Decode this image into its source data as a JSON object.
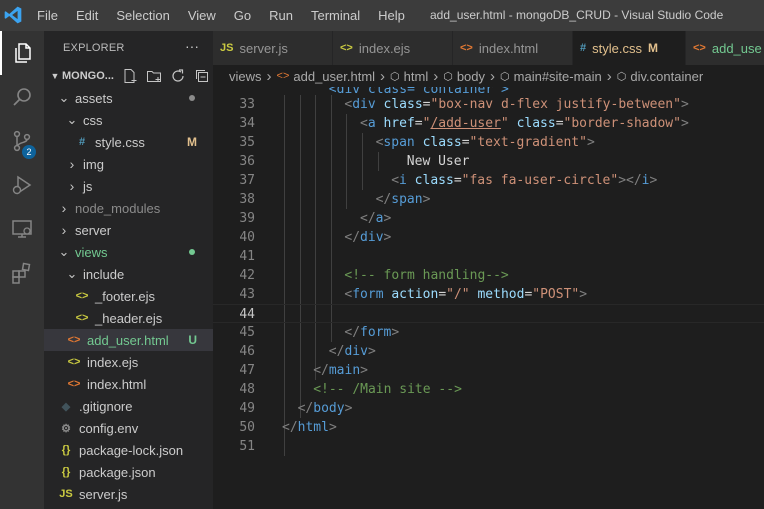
{
  "titlebar": {
    "menu": [
      "File",
      "Edit",
      "Selection",
      "View",
      "Go",
      "Run",
      "Terminal",
      "Help"
    ],
    "window_title": "add_user.html - mongoDB_CRUD - Visual Studio Code"
  },
  "activity_bar": {
    "items": [
      "files-icon",
      "search-icon",
      "source-control-icon",
      "run-debug-icon",
      "remote-explorer-icon",
      "extensions-icon"
    ],
    "source_control_badge": "2"
  },
  "explorer": {
    "header": "EXPLORER",
    "more": "···",
    "root": "MONGO...",
    "tree": [
      {
        "label": "assets",
        "kind": "folder-open",
        "depth": 1,
        "dot": "#8b8b8b"
      },
      {
        "label": "css",
        "kind": "folder-open",
        "depth": 2
      },
      {
        "label": "style.css",
        "kind": "css",
        "depth": 3,
        "status": "M"
      },
      {
        "label": "img",
        "kind": "folder",
        "depth": 2
      },
      {
        "label": "js",
        "kind": "folder",
        "depth": 2
      },
      {
        "label": "node_modules",
        "kind": "folder",
        "depth": 1,
        "muted": true
      },
      {
        "label": "server",
        "kind": "folder",
        "depth": 1
      },
      {
        "label": "views",
        "kind": "folder-open",
        "depth": 1,
        "dot": "#73c991",
        "color": "#73c991"
      },
      {
        "label": "include",
        "kind": "folder-open",
        "depth": 2
      },
      {
        "label": "_footer.ejs",
        "kind": "ejs",
        "depth": 3
      },
      {
        "label": "_header.ejs",
        "kind": "ejs",
        "depth": 3
      },
      {
        "label": "add_user.html",
        "kind": "html",
        "depth": 2,
        "status": "U",
        "selected": true,
        "color": "#73c991"
      },
      {
        "label": "index.ejs",
        "kind": "ejs",
        "depth": 2
      },
      {
        "label": "index.html",
        "kind": "html",
        "depth": 2
      },
      {
        "label": ".gitignore",
        "kind": "git",
        "depth": 1
      },
      {
        "label": "config.env",
        "kind": "gear",
        "depth": 1
      },
      {
        "label": "package-lock.json",
        "kind": "json",
        "depth": 1
      },
      {
        "label": "package.json",
        "kind": "json",
        "depth": 1
      },
      {
        "label": "server.js",
        "kind": "js",
        "depth": 1
      }
    ]
  },
  "tabs": [
    {
      "label": "server.js",
      "kind": "js"
    },
    {
      "label": "index.ejs",
      "kind": "ejs"
    },
    {
      "label": "index.html",
      "kind": "html"
    },
    {
      "label": "style.css",
      "kind": "css",
      "status": "M",
      "active": true
    },
    {
      "label": "add_use",
      "kind": "html",
      "color": "#73c991"
    }
  ],
  "breadcrumb": [
    {
      "label": "views",
      "kind": "none"
    },
    {
      "label": "add_user.html",
      "kind": "html"
    },
    {
      "label": "html",
      "kind": "element"
    },
    {
      "label": "body",
      "kind": "element"
    },
    {
      "label": "main#site-main",
      "kind": "element"
    },
    {
      "label": "div.container",
      "kind": "element"
    }
  ],
  "editor": {
    "first_line_partial": "<div class=\"container\">",
    "current_line": 44,
    "lines": [
      {
        "n": "33",
        "indent": 4,
        "tokens": [
          [
            "t-pun",
            "<"
          ],
          [
            "t-tag",
            "div"
          ],
          [
            "t-txt",
            " "
          ],
          [
            "t-attr",
            "class"
          ],
          [
            "t-txt",
            "="
          ],
          [
            "t-str",
            "\"box-nav d-flex justify-between\""
          ],
          [
            "t-pun",
            ">"
          ]
        ]
      },
      {
        "n": "34",
        "indent": 5,
        "tokens": [
          [
            "t-pun",
            "<"
          ],
          [
            "t-tag",
            "a"
          ],
          [
            "t-txt",
            " "
          ],
          [
            "t-attr",
            "href"
          ],
          [
            "t-txt",
            "="
          ],
          [
            "t-str",
            "\""
          ],
          [
            "t-str t-url",
            "/add-user"
          ],
          [
            "t-str",
            "\""
          ],
          [
            "t-txt",
            " "
          ],
          [
            "t-attr",
            "class"
          ],
          [
            "t-txt",
            "="
          ],
          [
            "t-str",
            "\"border-shadow\""
          ],
          [
            "t-pun",
            ">"
          ]
        ]
      },
      {
        "n": "35",
        "indent": 6,
        "tokens": [
          [
            "t-pun",
            "<"
          ],
          [
            "t-tag",
            "span"
          ],
          [
            "t-txt",
            " "
          ],
          [
            "t-attr",
            "class"
          ],
          [
            "t-txt",
            "="
          ],
          [
            "t-str",
            "\"text-gradient\""
          ],
          [
            "t-pun",
            ">"
          ]
        ]
      },
      {
        "n": "36",
        "indent": 8,
        "tokens": [
          [
            "t-txt",
            "New User"
          ]
        ]
      },
      {
        "n": "37",
        "indent": 7,
        "tokens": [
          [
            "t-pun",
            "<"
          ],
          [
            "t-tag",
            "i"
          ],
          [
            "t-txt",
            " "
          ],
          [
            "t-attr",
            "class"
          ],
          [
            "t-txt",
            "="
          ],
          [
            "t-str",
            "\"fas fa-user-circle\""
          ],
          [
            "t-pun",
            ">"
          ],
          [
            "t-pun",
            "</"
          ],
          [
            "t-tag",
            "i"
          ],
          [
            "t-pun",
            ">"
          ]
        ]
      },
      {
        "n": "38",
        "indent": 6,
        "tokens": [
          [
            "t-pun",
            "</"
          ],
          [
            "t-tag",
            "span"
          ],
          [
            "t-pun",
            ">"
          ]
        ]
      },
      {
        "n": "39",
        "indent": 5,
        "tokens": [
          [
            "t-pun",
            "</"
          ],
          [
            "t-tag",
            "a"
          ],
          [
            "t-pun",
            ">"
          ]
        ]
      },
      {
        "n": "40",
        "indent": 4,
        "tokens": [
          [
            "t-pun",
            "</"
          ],
          [
            "t-tag",
            "div"
          ],
          [
            "t-pun",
            ">"
          ]
        ]
      },
      {
        "n": "41",
        "indent": 0,
        "tokens": []
      },
      {
        "n": "42",
        "indent": 4,
        "tokens": [
          [
            "t-com",
            "<!-- form handling-->"
          ]
        ]
      },
      {
        "n": "43",
        "indent": 4,
        "tokens": [
          [
            "t-pun",
            "<"
          ],
          [
            "t-tag",
            "form"
          ],
          [
            "t-txt",
            " "
          ],
          [
            "t-attr",
            "action"
          ],
          [
            "t-txt",
            "="
          ],
          [
            "t-str",
            "\"/\""
          ],
          [
            "t-txt",
            " "
          ],
          [
            "t-attr",
            "method"
          ],
          [
            "t-txt",
            "="
          ],
          [
            "t-str",
            "\"POST\""
          ],
          [
            "t-pun",
            ">"
          ]
        ]
      },
      {
        "n": "44",
        "indent": 0,
        "tokens": []
      },
      {
        "n": "45",
        "indent": 4,
        "tokens": [
          [
            "t-pun",
            "</"
          ],
          [
            "t-tag",
            "form"
          ],
          [
            "t-pun",
            ">"
          ]
        ]
      },
      {
        "n": "46",
        "indent": 3,
        "tokens": [
          [
            "t-pun",
            "</"
          ],
          [
            "t-tag",
            "div"
          ],
          [
            "t-pun",
            ">"
          ]
        ]
      },
      {
        "n": "47",
        "indent": 2,
        "tokens": [
          [
            "t-pun",
            "</"
          ],
          [
            "t-tag",
            "main"
          ],
          [
            "t-pun",
            ">"
          ]
        ]
      },
      {
        "n": "48",
        "indent": 2,
        "tokens": [
          [
            "t-com",
            "<!-- /Main site -->"
          ]
        ]
      },
      {
        "n": "49",
        "indent": 1,
        "tokens": [
          [
            "t-pun",
            "</"
          ],
          [
            "t-tag",
            "body"
          ],
          [
            "t-pun",
            ">"
          ]
        ]
      },
      {
        "n": "50",
        "indent": 0,
        "tokens": [
          [
            "t-pun",
            "</"
          ],
          [
            "t-tag",
            "html"
          ],
          [
            "t-pun",
            ">"
          ]
        ]
      },
      {
        "n": "51",
        "indent": 0,
        "tokens": []
      }
    ]
  },
  "colors": {
    "accent_blue": "#007acc",
    "untracked_green": "#73c991",
    "modified_yellow": "#e2c08d"
  }
}
